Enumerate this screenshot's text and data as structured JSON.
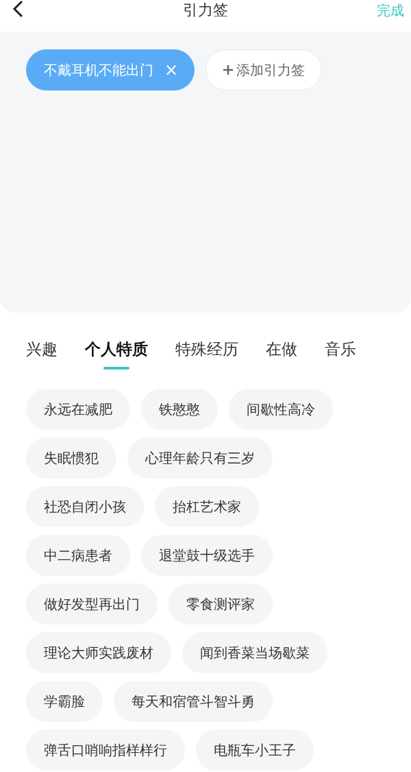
{
  "header": {
    "title": "引力签",
    "action": "完成"
  },
  "selected_tags": [
    {
      "label": "不戴耳机不能出门",
      "remove": "×"
    }
  ],
  "add_button": {
    "label": "添加引力签"
  },
  "tabs": [
    {
      "label": "兴趣",
      "selected": false
    },
    {
      "label": "个人特质",
      "selected": true
    },
    {
      "label": "特殊经历",
      "selected": false
    },
    {
      "label": "在做",
      "selected": false
    },
    {
      "label": "音乐",
      "selected": false
    }
  ],
  "tag_rows": [
    {
      "tags": [
        "永远在减肥",
        "铁憨憨",
        "间歇性高冷"
      ]
    },
    {
      "tags": [
        "失眠惯犯",
        "心理年龄只有三岁"
      ]
    },
    {
      "tags": [
        "社恐自闭小孩",
        "抬杠艺术家"
      ]
    },
    {
      "tags": [
        "中二病患者",
        "退堂鼓十级选手"
      ]
    },
    {
      "tags": [
        "做好发型再出门",
        "零食测评家"
      ]
    },
    {
      "tags": [
        "理论大师实践废材",
        "闻到香菜当场歇菜"
      ]
    },
    {
      "tags": [
        "学霸脸",
        "每天和宿管斗智斗勇"
      ]
    },
    {
      "tags": [
        "弹舌口哨响指样样行",
        "电瓶车小王子"
      ]
    }
  ]
}
